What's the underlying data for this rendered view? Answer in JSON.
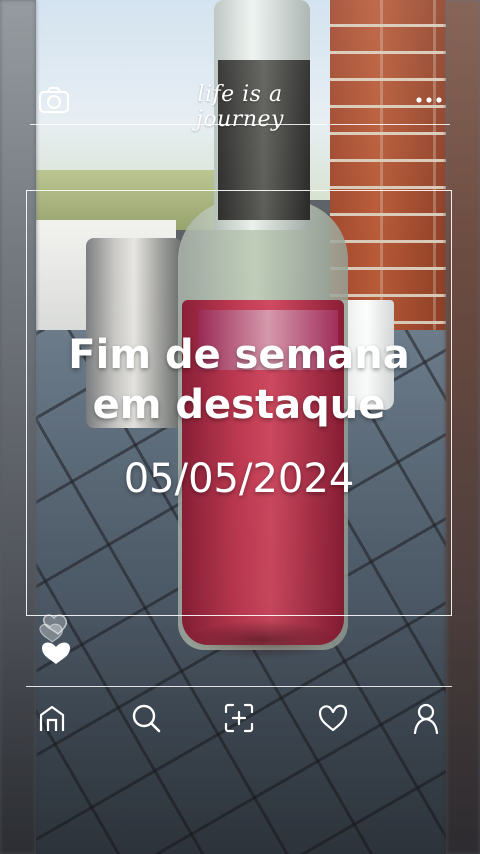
{
  "top_bar": {
    "brand_text": "life is a journey",
    "left_icon": "camera-icon",
    "right_icon": "more-dots-icon"
  },
  "post": {
    "title_line1": "Fim de semana",
    "title_line2": "em destaque",
    "date": "05/05/2024"
  },
  "reactions": {
    "icons": [
      "heart-outline-icon",
      "heart-filled-icon"
    ]
  },
  "bottom_nav": {
    "items": [
      {
        "icon": "home-icon"
      },
      {
        "icon": "search-icon"
      },
      {
        "icon": "add-photo-icon"
      },
      {
        "icon": "heart-icon"
      },
      {
        "icon": "profile-icon"
      }
    ]
  },
  "colors": {
    "overlay": "#ffffff",
    "liquid": "#c23b53",
    "brick": "#b85a37"
  }
}
